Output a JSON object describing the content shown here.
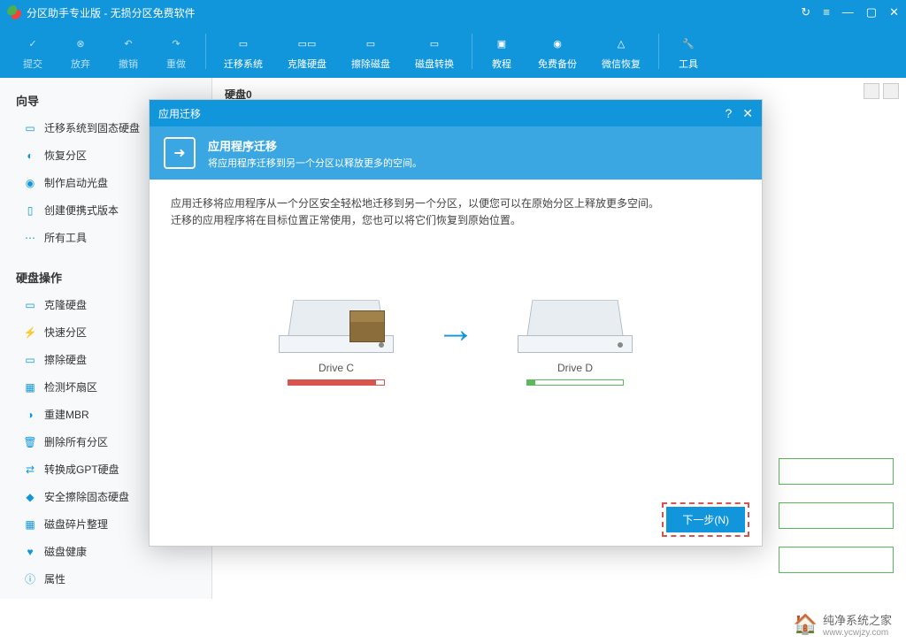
{
  "app": {
    "title": "分区助手专业版 - 无损分区免费软件"
  },
  "windowControls": {
    "refresh": "↻",
    "menu": "≡",
    "min": "—",
    "max": "▢",
    "close": "✕"
  },
  "toolbar": [
    {
      "label": "提交",
      "icon": "✓"
    },
    {
      "label": "放弃",
      "icon": "⊗"
    },
    {
      "label": "撤销",
      "icon": "↶"
    },
    {
      "label": "重做",
      "icon": "↷"
    },
    {
      "label": "迁移系统",
      "icon": "▭"
    },
    {
      "label": "克隆硬盘",
      "icon": "▭▭"
    },
    {
      "label": "擦除磁盘",
      "icon": "▭"
    },
    {
      "label": "磁盘转换",
      "icon": "▭"
    },
    {
      "label": "教程",
      "icon": "▣"
    },
    {
      "label": "免费备份",
      "icon": "◉"
    },
    {
      "label": "微信恢复",
      "icon": "△"
    },
    {
      "label": "工具",
      "icon": "🔧"
    }
  ],
  "sidebar": {
    "wizard_title": "向导",
    "wizard_items": [
      {
        "label": "迁移系统到固态硬盘",
        "icon": "▭"
      },
      {
        "label": "恢复分区",
        "icon": "◐"
      },
      {
        "label": "制作启动光盘",
        "icon": "◉"
      },
      {
        "label": "创建便携式版本",
        "icon": "▯"
      },
      {
        "label": "所有工具",
        "icon": "⋯"
      }
    ],
    "disk_title": "硬盘操作",
    "disk_items": [
      {
        "label": "克隆硬盘",
        "icon": "▭"
      },
      {
        "label": "快速分区",
        "icon": "⚡"
      },
      {
        "label": "擦除硬盘",
        "icon": "▭"
      },
      {
        "label": "检测坏扇区",
        "icon": "▦"
      },
      {
        "label": "重建MBR",
        "icon": "◑"
      },
      {
        "label": "删除所有分区",
        "icon": "🗑"
      },
      {
        "label": "转换成GPT硬盘",
        "icon": "⇄"
      },
      {
        "label": "安全擦除固态硬盘",
        "icon": "◆"
      },
      {
        "label": "磁盘碎片整理",
        "icon": "▦"
      },
      {
        "label": "磁盘健康",
        "icon": "♥"
      },
      {
        "label": "属性",
        "icon": "ⓘ"
      }
    ]
  },
  "content": {
    "disk_label": "硬盘0"
  },
  "dialog": {
    "title": "应用迁移",
    "header_title": "应用程序迁移",
    "header_sub": "将应用程序迁移到另一个分区以释放更多的空间。",
    "body_line1": "应用迁移将应用程序从一个分区安全轻松地迁移到另一个分区，以便您可以在原始分区上释放更多空间。",
    "body_line2": "迁移的应用程序将在目标位置正常使用，您也可以将它们恢复到原始位置。",
    "drive_c": "Drive C",
    "drive_d": "Drive D",
    "next_button": "下一步(N)"
  },
  "watermark": {
    "main": "纯净系统之家",
    "sub": "www.ycwjzy.com"
  }
}
